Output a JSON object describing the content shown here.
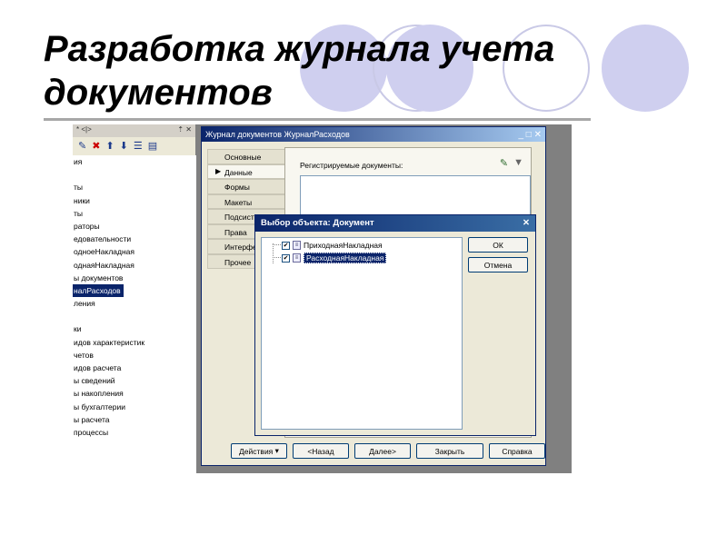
{
  "slide": {
    "title": "Разработка журнала учета документов"
  },
  "tree": {
    "header": "* <|>",
    "header_ctrls": "⇡ ✕",
    "items": [
      {
        "label": "ия"
      },
      {
        "label": ""
      },
      {
        "label": "ты"
      },
      {
        "label": "ники"
      },
      {
        "label": "ты"
      },
      {
        "label": "раторы"
      },
      {
        "label": "едовательности"
      },
      {
        "label": "одноеНакладная"
      },
      {
        "label": "однаяНакладная"
      },
      {
        "label": "ы документов"
      },
      {
        "label": "налРасходов"
      },
      {
        "label": "ления"
      },
      {
        "label": ""
      },
      {
        "label": "ки"
      },
      {
        "label": "идов характеристик"
      },
      {
        "label": "четов"
      },
      {
        "label": "идов расчета"
      },
      {
        "label": "ы сведений"
      },
      {
        "label": "ы накопления"
      },
      {
        "label": "ы бухгалтерии"
      },
      {
        "label": "ы расчета"
      },
      {
        "label": "процессы"
      }
    ]
  },
  "window": {
    "title": "Журнал документов ЖурналРасходов",
    "controls": "_ □ ✕",
    "tabs": [
      {
        "label": "Основные"
      },
      {
        "label": "Данные"
      },
      {
        "label": "Формы"
      },
      {
        "label": "Макеты"
      },
      {
        "label": "Подсистемы"
      },
      {
        "label": "Права"
      },
      {
        "label": "Интерфейсы"
      },
      {
        "label": "Прочее"
      }
    ],
    "registered_label": "Регистрируемые документы:",
    "buttons": {
      "actions": "Действия",
      "back": "<Назад",
      "next": "Далее>",
      "close": "Закрыть",
      "help": "Справка"
    }
  },
  "dialog": {
    "title": "Выбор объекта: Документ",
    "close": "✕",
    "items": [
      {
        "label": "ПриходнаяНакладная",
        "checked": true
      },
      {
        "label": "РасходнаяНакладная",
        "checked": true
      }
    ],
    "ok": "ОК",
    "cancel": "Отмена"
  }
}
